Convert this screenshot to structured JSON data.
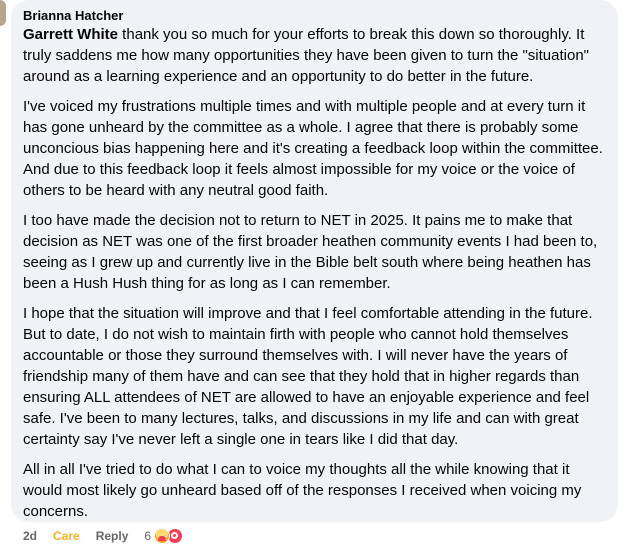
{
  "comment": {
    "author": "Brianna Hatcher",
    "mention": "Garrett White",
    "paragraphs": [
      " thank you so much for your efforts to break this down so thoroughly. It truly saddens me how many opportunities they have been given to turn the \"situation\" around as a learning experience and an opportunity to do better in the future.",
      "I've voiced my frustrations multiple times and with multiple people and at every turn it has gone unheard by the committee as a whole. I agree that there is probably some unconcious bias happening here and it's creating a feedback loop within the committee. And due to this feedback loop it feels almost impossible for my voice or the voice of others to be heard with any neutral good faith.",
      "I too have made the decision not to return to NET in 2025. It pains me to make that decision as NET was one of the first broader heathen community events I had been to, seeing as I grew up and currently live in the Bible belt south where being heathen has been a Hush Hush thing for as long as I can remember.",
      "I hope that the situation will improve and that I feel comfortable attending in the future. But to date, I do not wish to maintain firth with people who cannot hold themselves accountable or those they surround themselves with. I will never have the years of friendship many of them have and can see that they hold that in higher regards than ensuring ALL attendees of NET are allowed to have an enjoyable experience and feel safe. I've been to many lectures, talks, and discussions in my life and can with great certainty say I've never left a single one in tears like I did that day.",
      "All in all I've tried to do what I can to voice my thoughts all the while knowing that it would most likely go unheard based off of the responses I received when voicing my concerns."
    ]
  },
  "actions": {
    "time": "2d",
    "care_label": "Care",
    "reply_label": "Reply",
    "reaction_count": "6",
    "reaction_icons": [
      "care-reaction-icon",
      "love-reaction-icon"
    ]
  },
  "colors": {
    "bubble_bg": "#f0f2f5",
    "care_accent": "#f7b125",
    "meta_text": "#65676b"
  }
}
